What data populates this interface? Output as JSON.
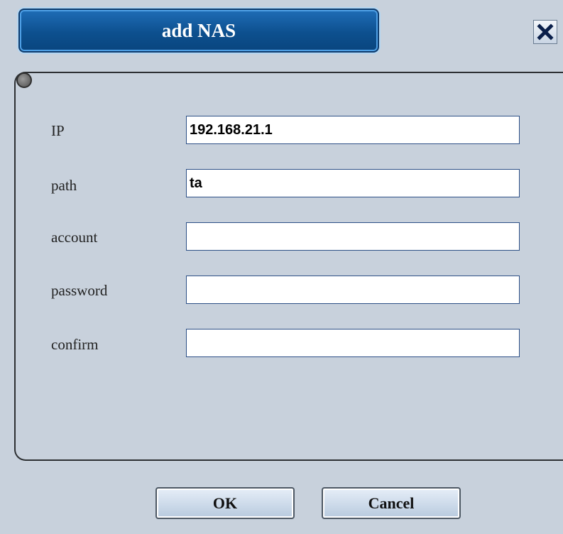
{
  "dialog": {
    "title": "add NAS",
    "close_symbol": "✕"
  },
  "status_indicator": {
    "icon": "status-led-icon"
  },
  "form": {
    "ip": {
      "label": "IP",
      "value": "192.168.21.1"
    },
    "path": {
      "label": "path",
      "value": "ta"
    },
    "account": {
      "label": "account",
      "value": ""
    },
    "password": {
      "label": "password",
      "value": ""
    },
    "confirm": {
      "label": "confirm",
      "value": ""
    }
  },
  "buttons": {
    "ok_label": "OK",
    "cancel_label": "Cancel"
  },
  "colors": {
    "title_bar": "#0d508f",
    "background": "#c8d1dc",
    "field_border": "#2c4f86"
  }
}
